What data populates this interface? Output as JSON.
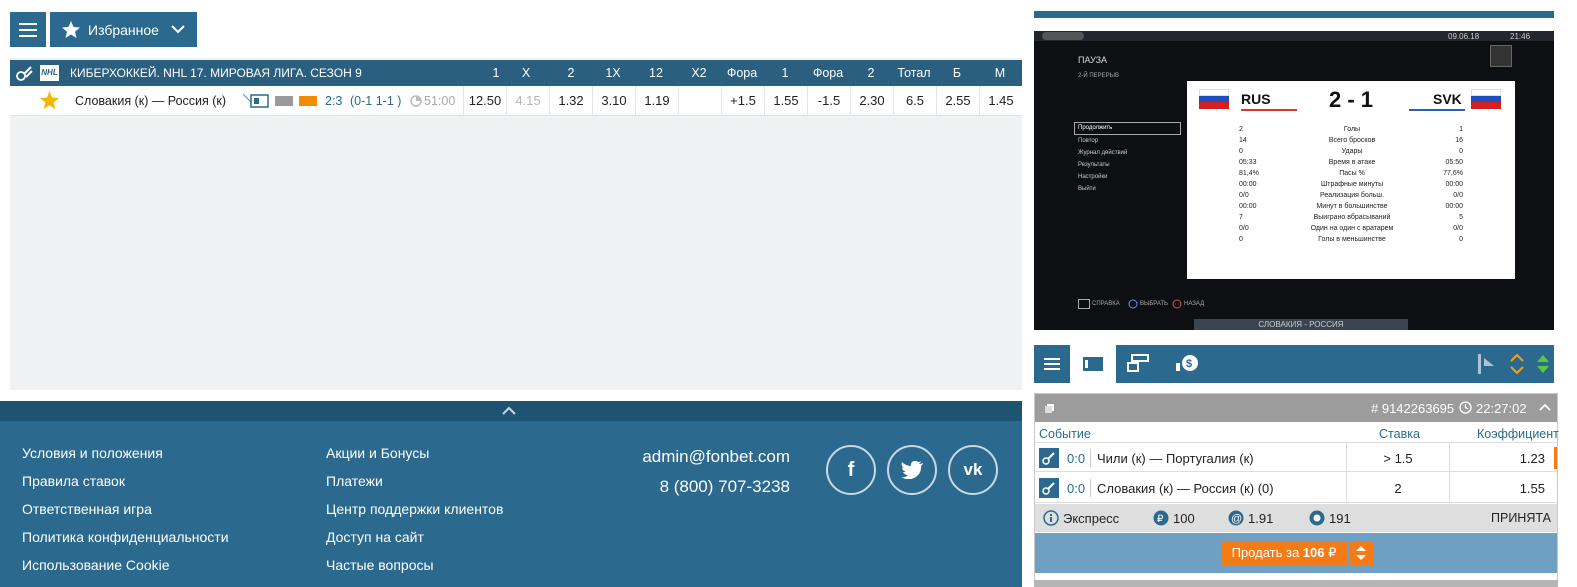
{
  "topbar": {
    "favorites_label": "Избранное"
  },
  "league": {
    "title": "КИБЕРХОККЕЙ. NHL 17. МИРОВАЯ ЛИГА. СЕЗОН 9",
    "columns": [
      "1",
      "X",
      "2",
      "1X",
      "12",
      "X2",
      "Фора",
      "1",
      "Фора",
      "2",
      "Тотал",
      "Б",
      "М"
    ]
  },
  "event": {
    "name": "Словакия (к) — Россия (к)",
    "score": "2:3",
    "periods": "(0-1 1-1 )",
    "time": "51:00",
    "odds": [
      "12.50",
      "4.15",
      "1.32",
      "3.10",
      "1.19",
      "",
      "+1.5",
      "1.55",
      "-1.5",
      "2.30",
      "6.5",
      "2.55",
      "1.45"
    ]
  },
  "footer": {
    "col1": [
      "Условия и положения",
      "Правила ставок",
      "Ответственная игра",
      "Политика конфиденциальности",
      "Использование Cookie"
    ],
    "col2": [
      "Акции и Бонусы",
      "Платежи",
      "Центр поддержки клиентов",
      "Доступ на сайт",
      "Частые вопросы"
    ],
    "email": "admin@fonbet.com",
    "phone": "8 (800) 707-3238"
  },
  "video": {
    "date": "09.06.18",
    "time": "21:46",
    "pause": "ПАУЗА",
    "period": "2-Й ПЕРЕРЫВ",
    "menu": [
      "Продолжить",
      "Повтор",
      "Журнал действий",
      "Результаты",
      "Настройки",
      "Выйти"
    ],
    "team1": "RUS",
    "team2": "SVK",
    "score": "2 - 1",
    "stats": [
      [
        "2",
        "Голы",
        "1"
      ],
      [
        "14",
        "Всего бросков",
        "16"
      ],
      [
        "0",
        "Удары",
        "0"
      ],
      [
        "05:33",
        "Время в атаке",
        "05:50"
      ],
      [
        "81,4%",
        "Пасы %",
        "77,6%"
      ],
      [
        "00:00",
        "Штрафные минуты",
        "00:00"
      ],
      [
        "0/0",
        "Реализация больш.",
        "0/0"
      ],
      [
        "00:00",
        "Минут в большинстве",
        "00:00"
      ],
      [
        "7",
        "Выиграно вбрасываний",
        "5"
      ],
      [
        "0/0",
        "Один на один с вратарем",
        "0/0"
      ],
      [
        "0",
        "Голы в меньшинстве",
        "0"
      ]
    ],
    "bottom_help": "СПРАВКА",
    "bottom_select": "ВЫБРАТЬ",
    "bottom_back": "НАЗАД",
    "caption": "СЛОВАКИЯ - РОССИЯ"
  },
  "coupon": {
    "id": "# 9142263695",
    "time": "22:27:02",
    "headers": {
      "event": "Событие",
      "stake": "Ставка",
      "coef": "Коэффициент"
    },
    "rows": [
      {
        "score": "0:0",
        "name": "Чили (к) — Португалия (к)",
        "stake": "> 1.5",
        "coef": "1.23"
      },
      {
        "score": "0:0",
        "name": "Словакия (к) — Россия (к) (0)",
        "stake": "2",
        "coef": "1.55"
      }
    ],
    "type": "Экспресс",
    "amount": "100",
    "total_coef": "1.91",
    "potential": "191",
    "status": "ПРИНЯТА",
    "sell_prefix": "Продать за",
    "sell_amount": "106",
    "currency": "₽"
  },
  "colors": {
    "primary": "#2b6a8e",
    "header": "#2b5f80",
    "orange": "#f47b16"
  }
}
